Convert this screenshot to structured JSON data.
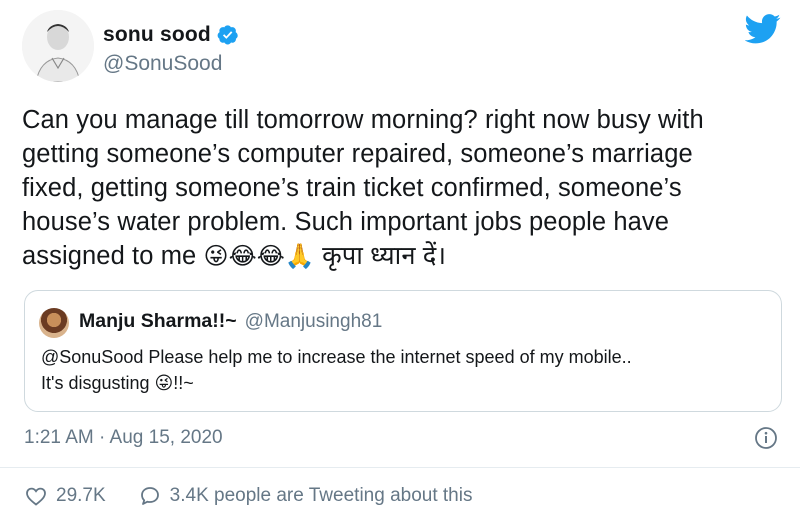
{
  "author": {
    "display_name": "sonu sood",
    "handle": "@SonuSood"
  },
  "tweet": {
    "text_lines": [
      "Can you manage till tomorrow morning? right now busy with",
      "getting someone’s computer repaired, someone’s marriage",
      "fixed, getting someone’s train ticket confirmed, someone’s",
      "house’s water problem. Such important jobs people have"
    ],
    "last_line_text": "assigned to me ",
    "last_line_emoji": "😜😂😂🙏",
    "last_line_hindi": " कृपा ध्यान दें।"
  },
  "quoted_tweet": {
    "display_name": "Manju Sharma!!~",
    "handle": "@Manjusingh81",
    "line1": "@SonuSood Please help me to increase the internet speed of my mobile..",
    "line2_text": "It's disgusting ",
    "line2_emoji": "😜",
    "line2_tail": "!!~"
  },
  "timestamp": "1:21 AM · Aug 15, 2020",
  "actions": {
    "likes": "29.7K",
    "tweeting": "3.4K people are Tweeting about this"
  },
  "colors": {
    "twitter_blue": "#1da1f2",
    "secondary_text": "#657786",
    "border": "#cfd9de"
  },
  "icons": [
    "twitter-bird-icon",
    "verified-badge-icon",
    "info-icon",
    "heart-icon",
    "speech-bubble-icon"
  ]
}
